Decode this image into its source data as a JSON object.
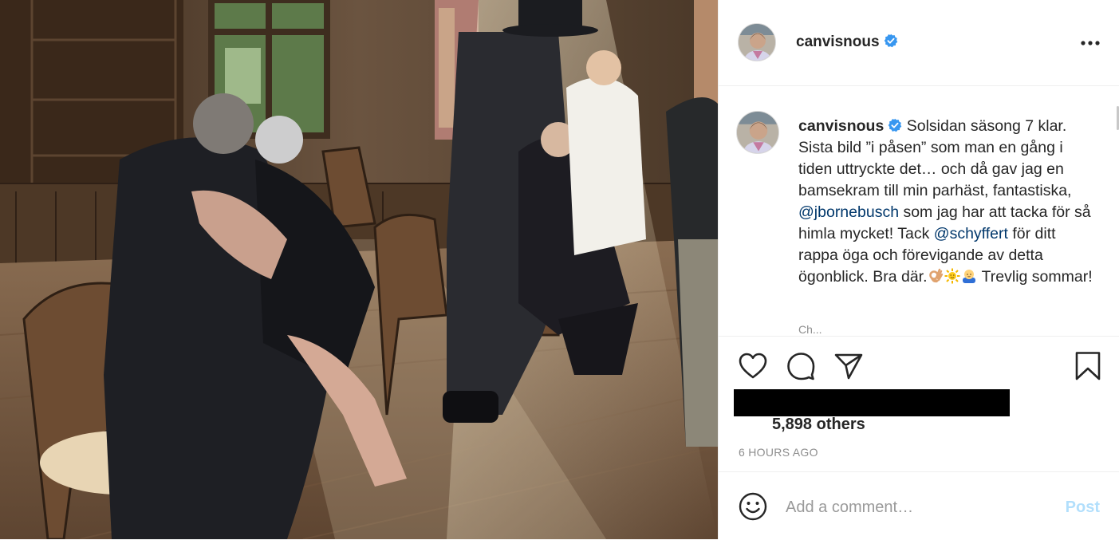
{
  "post": {
    "image_alt": "Photo of people embracing in a wood-paneled room"
  },
  "header": {
    "username": "canvisnous",
    "verified": true,
    "more_icon": "more-horizontal-icon"
  },
  "caption": {
    "username": "canvisnous",
    "text_1": " Solsidan säsong 7 klar. Sista bild ”i påsen” som man en gång i tiden uttryckte det… och då gav jag en bamsekram till min parhäst, fantastiska, ",
    "mention_1": "@jbornebusch",
    "text_2": " som jag har att tacka för så himla mycket! Tack ",
    "mention_2": "@schyffert",
    "text_3": " för ditt rappa öga och förevigande av detta ögonblick. Bra där.",
    "text_4": " Trevlig sommar!",
    "emojis": [
      "ok-hand-emoji",
      "sun-emoji",
      "baby-emoji"
    ],
    "more_text": "Ch..."
  },
  "actions": {
    "icons": [
      "heart-icon",
      "comment-icon",
      "share-icon",
      "bookmark-icon"
    ],
    "likes_text": "5,898 others",
    "timestamp": "6 HOURS AGO"
  },
  "comment": {
    "emoji_icon": "smiley-icon",
    "placeholder": "Add a comment…",
    "post_label": "Post"
  },
  "colors": {
    "link": "#00376b",
    "verified_badge": "#3897f0",
    "post_disabled": "#b2dffc",
    "secondary_text": "#8e8e8e"
  }
}
